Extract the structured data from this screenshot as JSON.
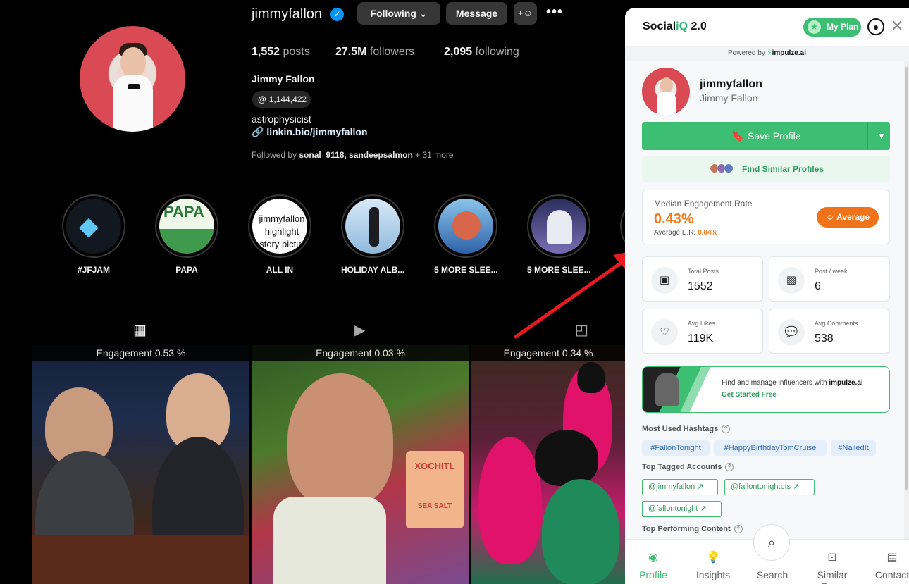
{
  "instagram": {
    "username": "jimmyfallon",
    "buttons": {
      "following": "Following",
      "message": "Message",
      "add_user": "+",
      "more": "•••"
    },
    "stats": [
      {
        "value": "1,552",
        "label": "posts"
      },
      {
        "value": "27.5M",
        "label": "followers"
      },
      {
        "value": "2,095",
        "label": "following"
      }
    ],
    "full_name": "Jimmy Fallon",
    "threads_count": "1,144,422",
    "bio": "astrophysicist",
    "link": "linkin.bio/jimmyfallon",
    "followed_by": {
      "prefix": "Followed by",
      "users": "sonal_9118, sandeepsalmon",
      "suffix": "+ 31 more"
    },
    "highlights": [
      {
        "label": "#JFJAM",
        "color": "#1f2a3a"
      },
      {
        "label": "PAPA",
        "color": "#3f9a4e"
      },
      {
        "label": "ALL IN",
        "color": "#ffffff",
        "overlay": "jimmyfallon highlight story pictur"
      },
      {
        "label": "HOLIDAY ALB...",
        "color": "#b9d6ee"
      },
      {
        "label": "5 MORE SLEE...",
        "color": "#3573b5"
      },
      {
        "label": "5 MORE SLEE...",
        "color": "#3b3f7a"
      }
    ],
    "posts": [
      {
        "engagement": "Engagement 0.53 %"
      },
      {
        "engagement": "Engagement 0.03 %"
      },
      {
        "engagement": "Engagement 0.34 %"
      }
    ],
    "post2_sign": "XOCHITL",
    "post2_sub": "SEA SALT"
  },
  "panel": {
    "brand": "Social",
    "brand_iq": "iQ",
    "brand_version": " 2.0",
    "my_plan": "My Plan",
    "powered_by": "Powered by",
    "powered_brand": "impulze.ai",
    "profile": {
      "username": "jimmyfallon",
      "name": "Jimmy Fallon"
    },
    "save_profile": "Save Profile",
    "find_similar": "Find Similar Profiles",
    "engagement": {
      "title": "Median Engagement Rate",
      "value": "0.43%",
      "avg_label": "Average E.R:",
      "avg_value": "0.84%",
      "badge": "Average"
    },
    "stats": [
      {
        "label": "Total Posts",
        "value": "1552",
        "icon": "calendar-icon"
      },
      {
        "label": "Post / week",
        "value": "6",
        "icon": "image-icon"
      },
      {
        "label": "Avg Likes",
        "value": "119K",
        "icon": "heart-icon"
      },
      {
        "label": "Avg Comments",
        "value": "538",
        "icon": "comment-icon"
      }
    ],
    "promo": {
      "text": "Find and manage influencers with",
      "brand": "impulze.ai",
      "cta": "Get Started Free"
    },
    "hashtags_title": "Most Used Hashtags",
    "hashtags": [
      "#FallonTonight",
      "#HappyBirthdayTomCruise",
      "#NailedIt"
    ],
    "tagged_title": "Top Tagged Accounts",
    "tagged": [
      "@jimmyfallon",
      "@fallontonightbts",
      "@fallontonight"
    ],
    "top_content_title": "Top Performing Content",
    "nav": [
      {
        "label": "Profile",
        "icon": "user-circle-icon",
        "active": true
      },
      {
        "label": "Insights",
        "icon": "lightbulb-icon",
        "active": false
      },
      {
        "label": "Search",
        "icon": "search-icon",
        "active": false
      },
      {
        "label": "Similar Ones",
        "icon": "similar-icon",
        "active": false
      },
      {
        "label": "Contact",
        "icon": "contact-icon",
        "active": false
      }
    ],
    "accent_color": "#3cbf72",
    "warning_color": "#f0731a"
  }
}
